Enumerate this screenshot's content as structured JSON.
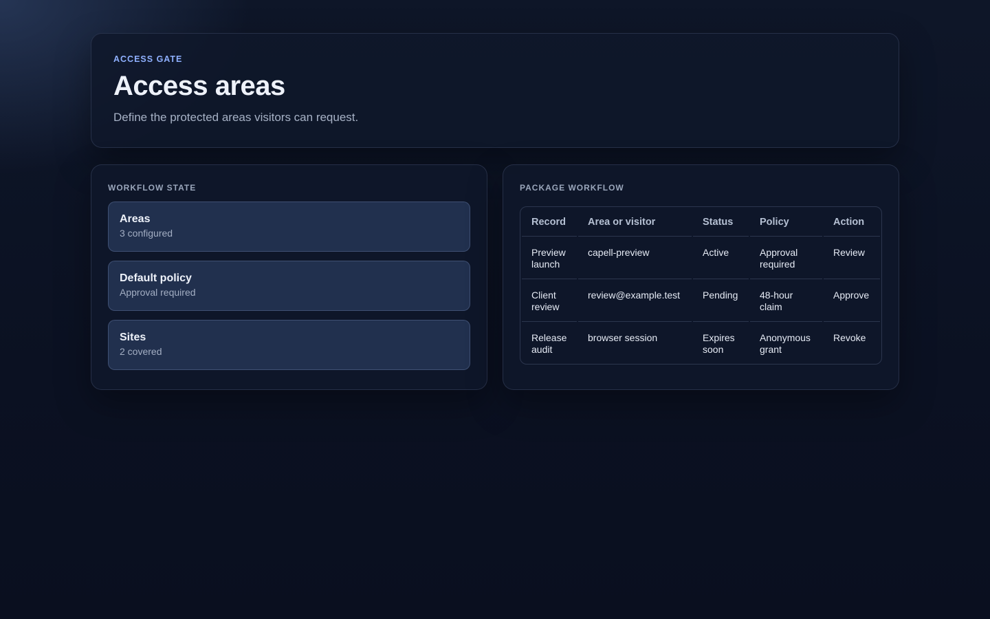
{
  "header": {
    "eyebrow": "ACCESS GATE",
    "title": "Access areas",
    "subtitle": "Define the protected areas visitors can request."
  },
  "workflow_state": {
    "heading": "WORKFLOW STATE",
    "cards": [
      {
        "title": "Areas",
        "value": "3 configured"
      },
      {
        "title": "Default policy",
        "value": "Approval required"
      },
      {
        "title": "Sites",
        "value": "2 covered"
      }
    ]
  },
  "package_workflow": {
    "heading": "PACKAGE WORKFLOW",
    "columns": [
      "Record",
      "Area or visitor",
      "Status",
      "Policy",
      "Action"
    ],
    "rows": [
      {
        "record": "Preview launch",
        "area": "capell-preview",
        "status": "Active",
        "policy": "Approval required",
        "action": "Review"
      },
      {
        "record": "Client review",
        "area": "review@example.test",
        "status": "Pending",
        "policy": "48-hour claim",
        "action": "Approve"
      },
      {
        "record": "Release audit",
        "area": "browser session",
        "status": "Expires soon",
        "policy": "Anonymous grant",
        "action": "Revoke"
      }
    ]
  }
}
